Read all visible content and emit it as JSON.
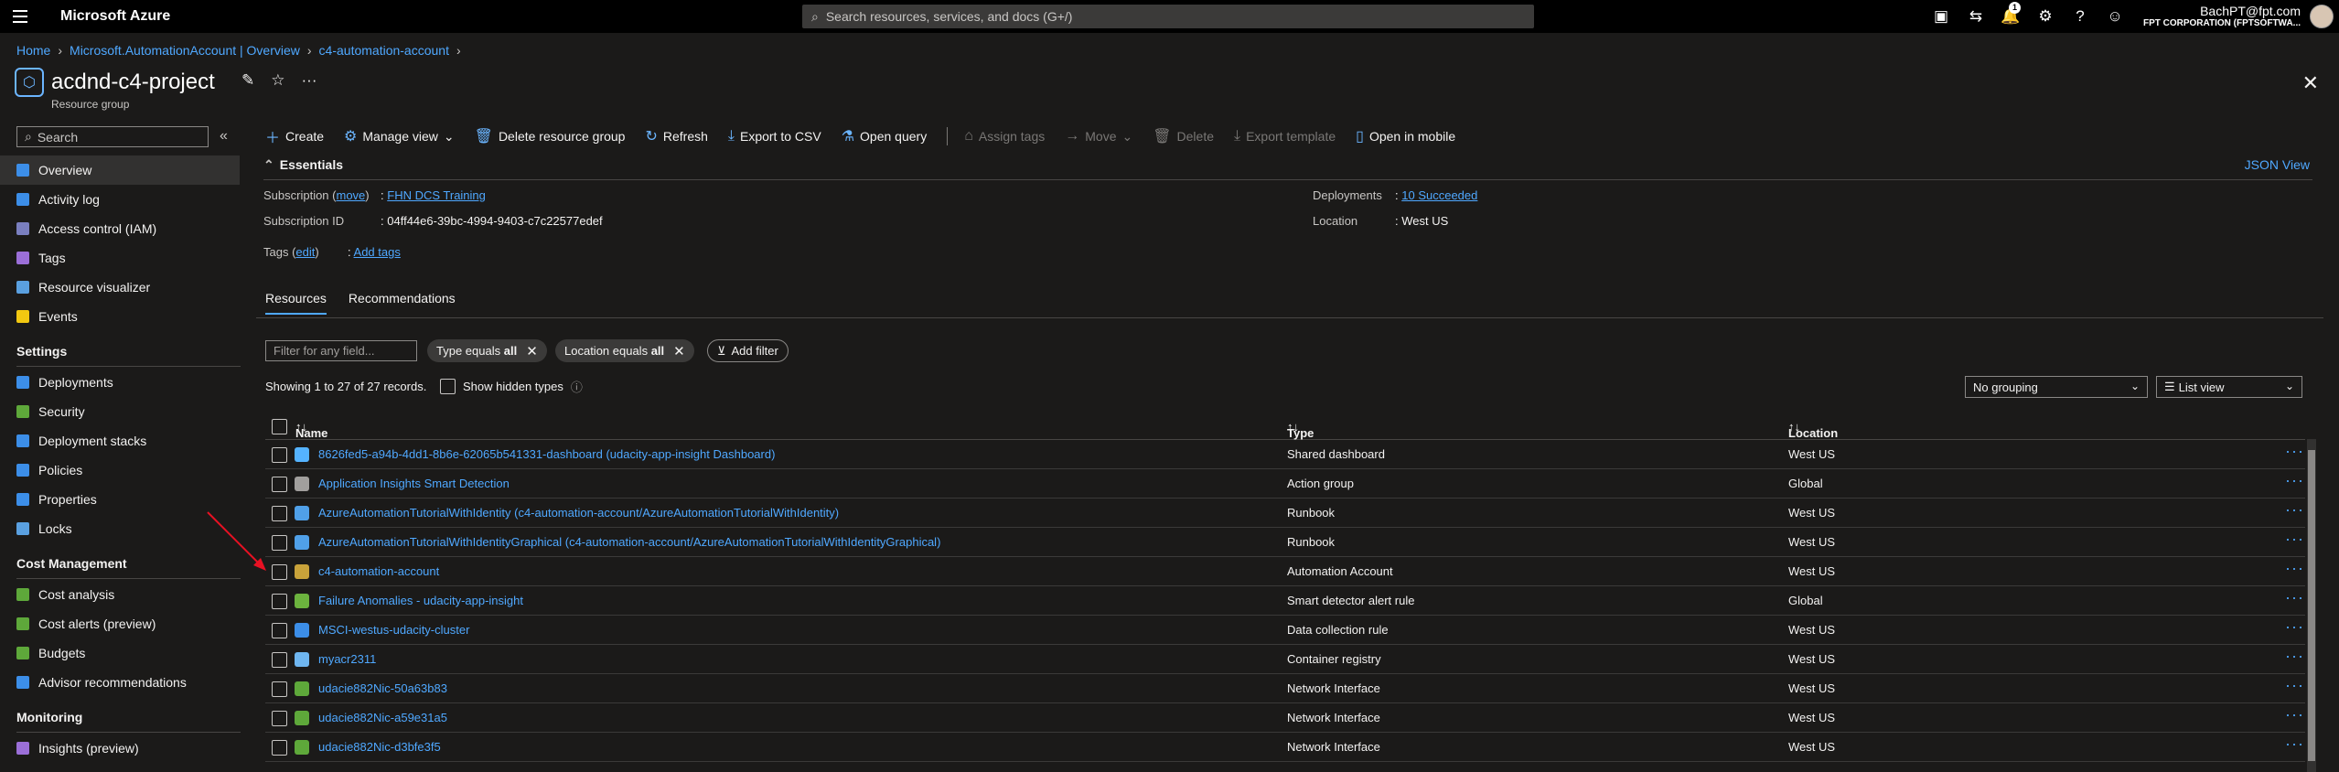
{
  "topbar": {
    "brand": "Microsoft Azure",
    "search_placeholder": "Search resources, services, and docs (G+/)",
    "notif_count": "1",
    "user_email": "BachPT@fpt.com",
    "user_org": "FPT CORPORATION (FPTSOFTWA..."
  },
  "breadcrumb": [
    "Home",
    "Microsoft.AutomationAccount | Overview",
    "c4-automation-account"
  ],
  "header": {
    "title": "acdnd-c4-project",
    "subtitle": "Resource group"
  },
  "sidebar": {
    "search_placeholder": "Search",
    "items": [
      "Overview",
      "Activity log",
      "Access control (IAM)",
      "Tags",
      "Resource visualizer",
      "Events"
    ],
    "settings_heading": "Settings",
    "settings_items": [
      "Deployments",
      "Security",
      "Deployment stacks",
      "Policies",
      "Properties",
      "Locks"
    ],
    "cost_heading": "Cost Management",
    "cost_items": [
      "Cost analysis",
      "Cost alerts (preview)",
      "Budgets",
      "Advisor recommendations"
    ],
    "monitoring_heading": "Monitoring",
    "monitoring_items": [
      "Insights (preview)"
    ]
  },
  "toolbar": {
    "create": "Create",
    "manage_view": "Manage view",
    "delete_rg": "Delete resource group",
    "refresh": "Refresh",
    "export_csv": "Export to CSV",
    "open_query": "Open query",
    "assign_tags": "Assign tags",
    "move": "Move",
    "delete": "Delete",
    "export_template": "Export template",
    "open_mobile": "Open in mobile"
  },
  "essentials": {
    "heading": "Essentials",
    "json_view": "JSON View",
    "subscription_label": "Subscription (",
    "subscription_move": "move",
    "subscription_close": ")",
    "subscription_value": "FHN DCS Training",
    "subscription_id_label": "Subscription ID",
    "subscription_id_value": "04ff44e6-39bc-4994-9403-c7c22577edef",
    "tags_label": "Tags (",
    "tags_edit": "edit",
    "tags_close": ")",
    "tags_value": "Add tags",
    "deployments_label": "Deployments",
    "deployments_value": "10 Succeeded",
    "location_label": "Location",
    "location_value": "West US",
    "colon": ":"
  },
  "tabs": {
    "resources": "Resources",
    "recommendations": "Recommendations"
  },
  "filters": {
    "placeholder": "Filter for any field...",
    "type_pill": "Type equals",
    "type_val": "all",
    "location_pill": "Location equals",
    "location_val": "all",
    "add_filter": "Add filter"
  },
  "records": {
    "showing": "Showing 1 to 27 of 27 records.",
    "show_hidden": "Show hidden types",
    "grouping": "No grouping",
    "view": "List view"
  },
  "table": {
    "headers": {
      "name": "Name",
      "type": "Type",
      "location": "Location"
    },
    "rows": [
      {
        "name": "8626fed5-a94b-4dd1-8b6e-62065b541331-dashboard (udacity-app-insight Dashboard)",
        "type": "Shared dashboard",
        "location": "West US",
        "icon_color": "#55b3ff"
      },
      {
        "name": "Application Insights Smart Detection",
        "type": "Action group",
        "location": "Global",
        "icon_color": "#a19f9d"
      },
      {
        "name": "AzureAutomationTutorialWithIdentity (c4-automation-account/AzureAutomationTutorialWithIdentity)",
        "type": "Runbook",
        "location": "West US",
        "icon_color": "#50a0e8"
      },
      {
        "name": "AzureAutomationTutorialWithIdentityGraphical (c4-automation-account/AzureAutomationTutorialWithIdentityGraphical)",
        "type": "Runbook",
        "location": "West US",
        "icon_color": "#50a0e8"
      },
      {
        "name": "c4-automation-account",
        "type": "Automation Account",
        "location": "West US",
        "icon_color": "#c8a23a"
      },
      {
        "name": "Failure Anomalies - udacity-app-insight",
        "type": "Smart detector alert rule",
        "location": "Global",
        "icon_color": "#6cb33e"
      },
      {
        "name": "MSCI-westus-udacity-cluster",
        "type": "Data collection rule",
        "location": "West US",
        "icon_color": "#3c8ee8"
      },
      {
        "name": "myacr2311",
        "type": "Container registry",
        "location": "West US",
        "icon_color": "#6fb6f0"
      },
      {
        "name": "udacie882Nic-50a63b83",
        "type": "Network Interface",
        "location": "West US",
        "icon_color": "#5ea83a"
      },
      {
        "name": "udacie882Nic-a59e31a5",
        "type": "Network Interface",
        "location": "West US",
        "icon_color": "#5ea83a"
      },
      {
        "name": "udacie882Nic-d3bfe3f5",
        "type": "Network Interface",
        "location": "West US",
        "icon_color": "#5ea83a"
      }
    ]
  },
  "icons": {
    "hamburger": "☰",
    "search": "⌕",
    "cloudshell": "▣",
    "directory": "⇆",
    "bell": "🔔",
    "gear": "⚙",
    "help": "?",
    "feedback": "☺"
  }
}
